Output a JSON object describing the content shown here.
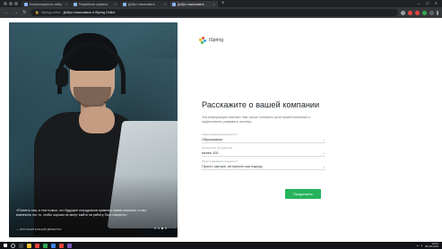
{
  "browser": {
    "tabs": [
      {
        "label": "Консультация по сайту",
        "active": false
      },
      {
        "label": "Разработка сервиса",
        "active": false
      },
      {
        "label": "Добро пожаловать",
        "active": false
      },
      {
        "label": "Добро пожаловать",
        "active": true
      }
    ],
    "url_host": "ispring.online",
    "url_path": "Добро пожаловать в iSpring Online"
  },
  "hero": {
    "quote": "«Платить там, и тем только, что будущее сотрудников нравится самим знаниям, и там, вовлекать это то, чтобы хорошо не могут выйти на работу. Еще говорить»",
    "author": "— ИСПОЛНИТЕЛЬНЫЙ ДИРЕКТОР"
  },
  "logo": {
    "text": "iSpring"
  },
  "form": {
    "title": "Расскажите о вашей компании",
    "description": "Эта информация поможет нам лучше понимать цели вашей компании и эффективнее развивать систему.",
    "fields": [
      {
        "label": "Сфера вашей деятельности",
        "value": "Образование"
      },
      {
        "label": "Количество сотрудников",
        "value": "менее 100"
      },
      {
        "label": "Когда планируете внедрить?",
        "value": "Просто смотрю, интересно как подход"
      }
    ],
    "submit_label": "Продолжить"
  },
  "taskbar": {
    "time": "10:01",
    "date": "08.08.2019"
  },
  "colors": {
    "accent_green": "#24b35c",
    "chrome_dark": "#202124"
  }
}
